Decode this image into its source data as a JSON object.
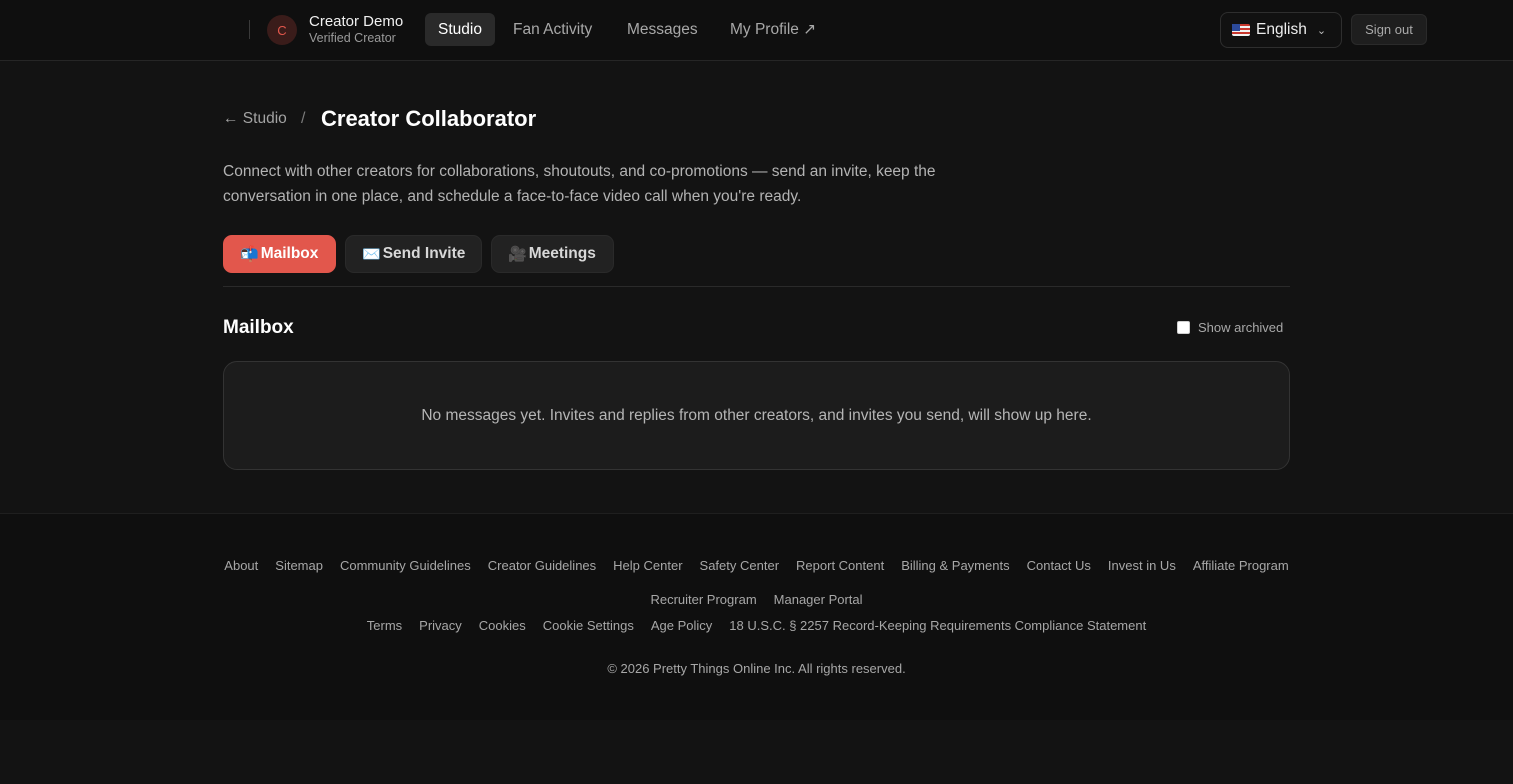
{
  "header": {
    "avatar_initial": "C",
    "user_name": "Creator Demo",
    "user_role": "Verified Creator",
    "nav": [
      {
        "label": "Studio",
        "active": true
      },
      {
        "label": "Fan Activity",
        "active": false
      },
      {
        "label": "Messages",
        "active": false
      },
      {
        "label": "My Profile ↗",
        "active": false
      }
    ],
    "language": {
      "flag": "us-flag-icon",
      "label": "English"
    },
    "signout_label": "Sign out"
  },
  "breadcrumb": {
    "back_label": "← Studio",
    "separator": "/",
    "title": "Creator Collaborator"
  },
  "description": "Connect with other creators for collaborations, shoutouts, and co-promotions — send an invite, keep the conversation in one place, and schedule a face-to-face video call when you're ready.",
  "tabs": [
    {
      "icon": "📬",
      "label": "Mailbox",
      "active": true
    },
    {
      "icon": "✉️",
      "label": "Send Invite",
      "active": false
    },
    {
      "icon": "🎥",
      "label": "Meetings",
      "active": false
    }
  ],
  "mailbox": {
    "title": "Mailbox",
    "show_archived_label": "Show archived",
    "show_archived_checked": false,
    "empty_message": "No messages yet. Invites and replies from other creators, and invites you send, will show up here."
  },
  "footer": {
    "row1": [
      "About",
      "Sitemap",
      "Community Guidelines",
      "Creator Guidelines",
      "Help Center",
      "Safety Center",
      "Report Content",
      "Billing & Payments",
      "Contact Us",
      "Invest in Us",
      "Affiliate Program"
    ],
    "row2": [
      "Recruiter Program",
      "Manager Portal"
    ],
    "row3": [
      "Terms",
      "Privacy",
      "Cookies",
      "Cookie Settings",
      "Age Policy",
      "18 U.S.C. § 2257 Record-Keeping Requirements Compliance Statement"
    ],
    "copyright": "© 2026 Pretty Things Online Inc. All rights reserved."
  },
  "colors": {
    "accent": "#e2574c",
    "background": "#131313",
    "header_bg": "#0f0f0f"
  }
}
